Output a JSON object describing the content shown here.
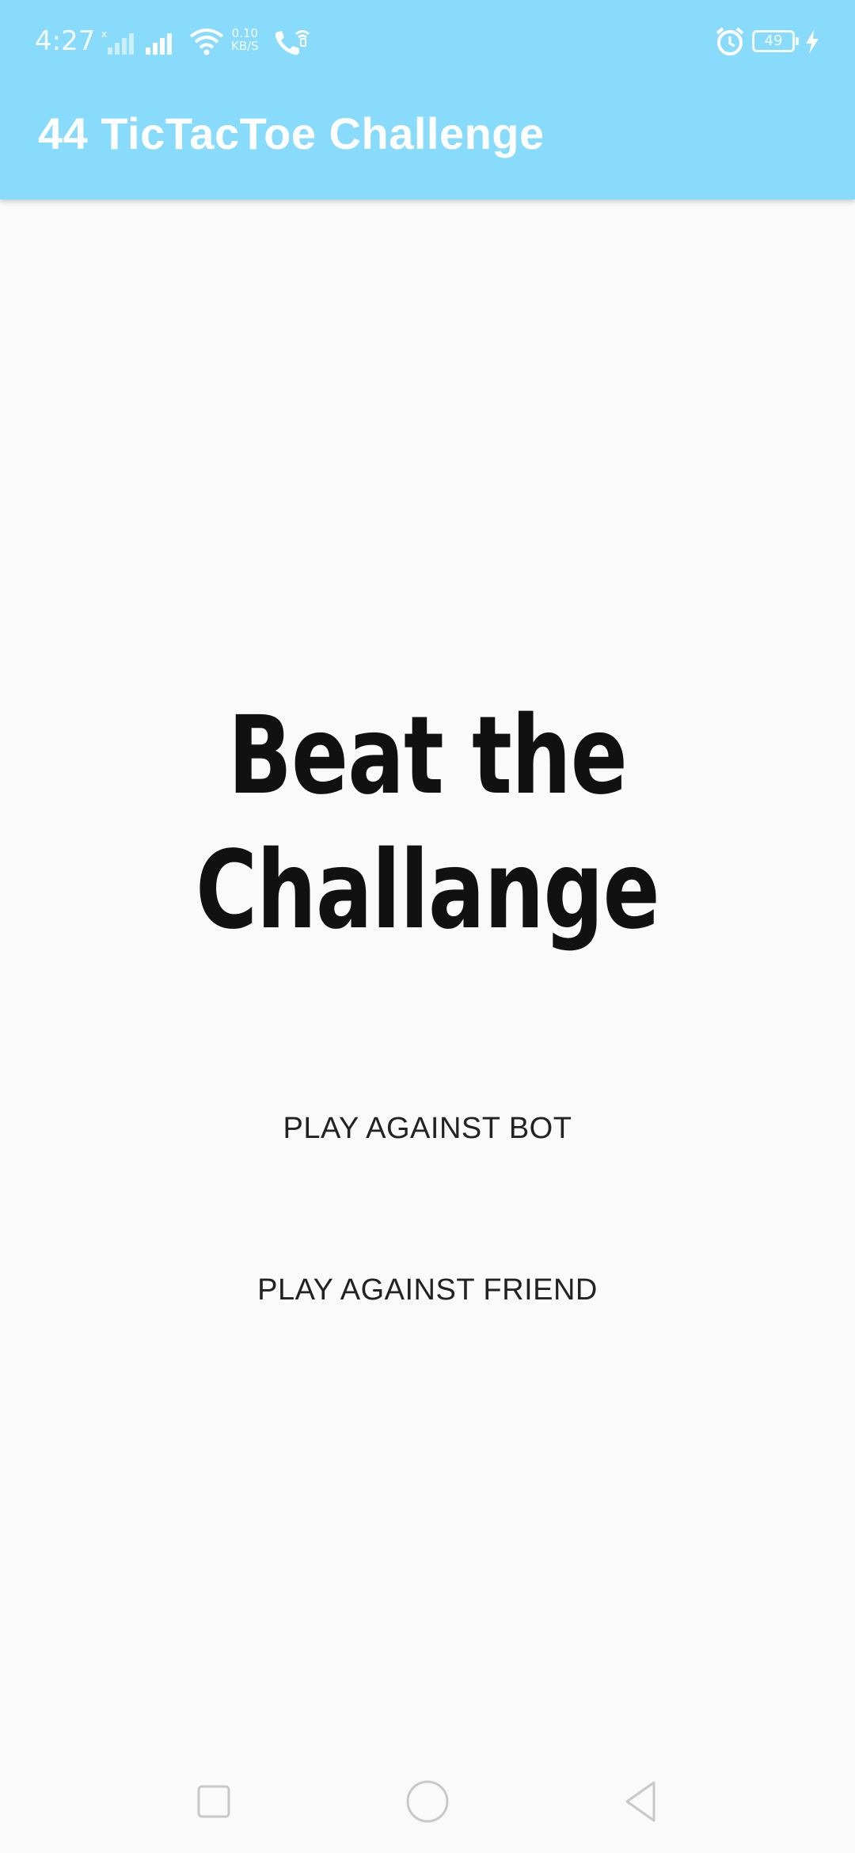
{
  "status_bar": {
    "time": "4:27",
    "net_speed_value": "0.10",
    "net_speed_unit": "KB/S",
    "battery_level": "49",
    "icons": [
      "no-sim-signal-icon",
      "signal-icon",
      "wifi-icon",
      "volte-call-icon",
      "alarm-icon",
      "battery-icon",
      "charging-icon"
    ]
  },
  "app_bar": {
    "title": "44 TicTacToe Challenge"
  },
  "main": {
    "headline_line1": "Beat the",
    "headline_line2": "Challange",
    "buttons": {
      "play_bot": "PLAY AGAINST BOT",
      "play_friend": "PLAY AGAINST FRIEND"
    }
  },
  "nav_bar": {
    "icons": [
      "recents-square-icon",
      "home-circle-icon",
      "back-triangle-icon"
    ]
  },
  "colors": {
    "header_bg": "#89dbfb",
    "page_bg": "#fafafa",
    "headline_text": "#111111",
    "button_text": "#222222"
  }
}
